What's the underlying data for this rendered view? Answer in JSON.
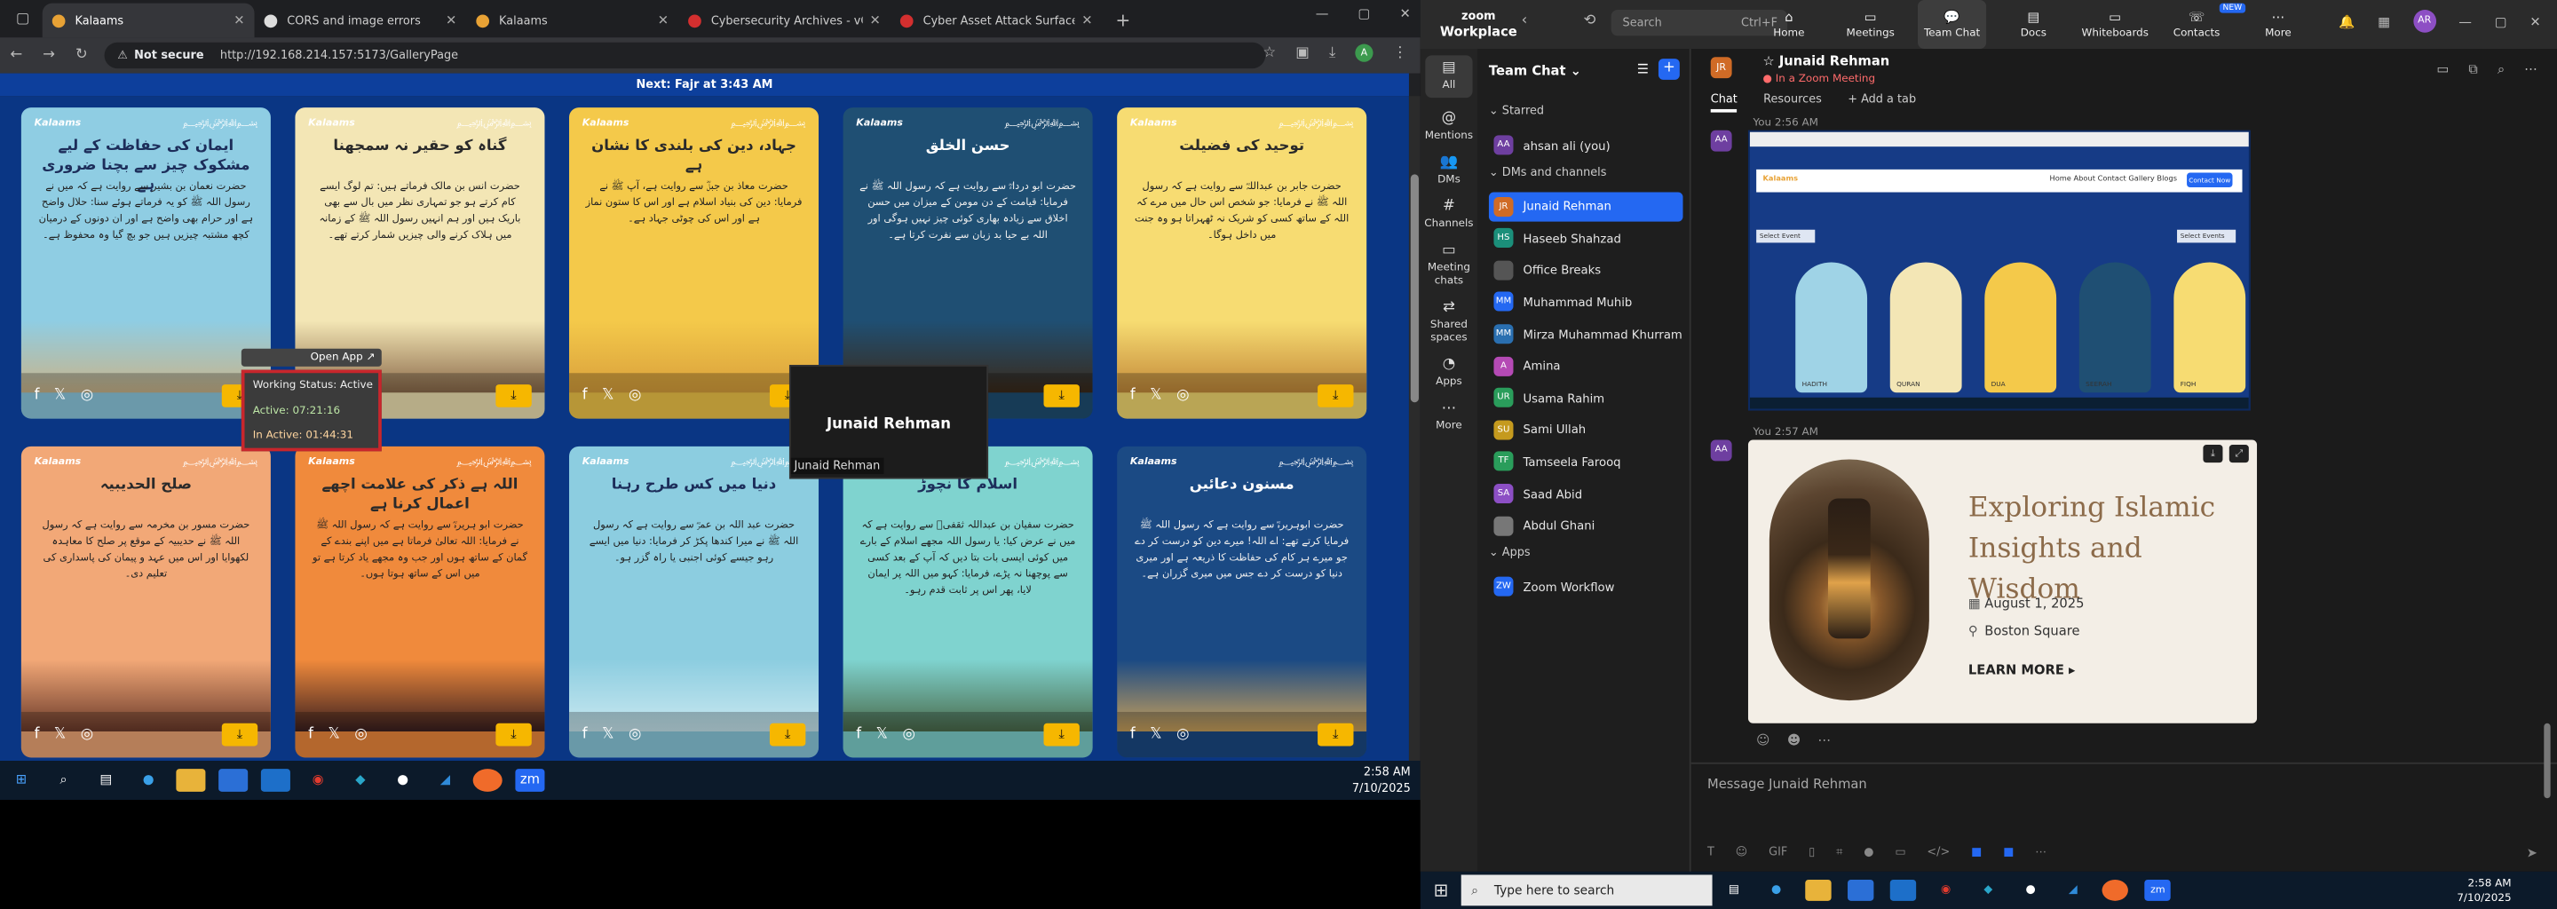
{
  "browser": {
    "tabs": [
      {
        "title": "Kalaams",
        "active": true,
        "color": "#e8a235"
      },
      {
        "title": "CORS and image errors",
        "active": false,
        "color": "#dddddd"
      },
      {
        "title": "Kalaams",
        "active": false,
        "color": "#e8a235"
      },
      {
        "title": "Cybersecurity Archives - vClou",
        "active": false,
        "color": "#d32f2f"
      },
      {
        "title": "Cyber Asset Attack Surface Ma",
        "active": false,
        "color": "#d32f2f"
      }
    ],
    "security_label": "Not secure",
    "url": "http://192.168.214.157:5173/GalleryPage",
    "banner": "Next: Fajr at 3:43 AM"
  },
  "gallery": {
    "logo": "Kalaams",
    "cards": [
      {
        "title": "ایمان کی حفاظت کے لیے مشکوک چیز سے بچنا ضروری ہے",
        "body": "حضرت نعمان بن بشیر سے روایت ہے کہ میں نے رسول اللہ ﷺ کو یہ فرماتے ہوئے سنا: حلال واضح ہے اور حرام بھی واضح ہے اور ان دونوں کے درمیان کچھ مشتبہ چیزیں ہیں جو بچ گیا وہ محفوظ ہے۔",
        "bg": "#8fcde3",
        "title_color": "#1c2d5a"
      },
      {
        "title": "گناہ کو حقیر نہ سمجھنا",
        "body": "حضرت انس بن مالک فرماتے ہیں: تم لوگ ایسے کام کرتے ہو جو تمہاری نظر میں بال سے بھی باریک ہیں اور ہم انہیں رسول اللہ ﷺ کے زمانہ میں ہلاک کرنے والی چیزیں شمار کرتے تھے۔",
        "bg": "#f3e6b5",
        "title_color": "#2a2a2a"
      },
      {
        "title": "جہاد، دین کی بلندی کا نشان ہے",
        "body": "حضرت معاذ بن جبلؓ سے روایت ہے، آپ ﷺ نے فرمایا: دین کی بنیاد اسلام ہے اور اس کا ستون نماز ہے اور اس کی چوٹی جہاد ہے۔",
        "bg": "#f4c94a",
        "title_color": "#2a2a2a"
      },
      {
        "title": "حسن الخلق",
        "body": "حضرت ابو درداءؓ سے روایت ہے کہ رسول اللہ ﷺ نے فرمایا: قیامت کے دن مومن کے میزان میں حسن اخلاق سے زیادہ بھاری کوئی چیز نہیں ہوگی اور اللہ بے حیا بد زبان سے نفرت کرتا ہے۔",
        "bg": "#1f4f73",
        "title_color": "#ffffff"
      },
      {
        "title": "توحید کی فضیلت",
        "body": "حضرت جابر بن عبداللہؓ سے روایت ہے کہ رسول اللہ ﷺ نے فرمایا: جو شخص اس حال میں مرے کہ اللہ کے ساتھ کسی کو شریک نہ ٹھہراتا ہو وہ جنت میں داخل ہوگا۔",
        "bg": "#f7dc72",
        "title_color": "#2a2a2a"
      },
      {
        "title": "صلح الحدیبیہ",
        "body": "حضرت مسور بن مخرمہ سے روایت ہے کہ رسول اللہ ﷺ نے حدیبیہ کے موقع پر صلح کا معاہدہ لکھوایا اور اس میں عہد و پیمان کی پاسداری کی تعلیم دی۔",
        "bg": "#f2a877",
        "title_color": "#2a2a2a"
      },
      {
        "title": "اللہ ہے ذکر کی علامت اچھے اعمال کرنا ہے",
        "body": "حضرت ابو ہریرہؓ سے روایت ہے کہ رسول اللہ ﷺ نے فرمایا: اللہ تعالیٰ فرماتا ہے میں اپنے بندے کے گمان کے ساتھ ہوں اور جب وہ مجھے یاد کرتا ہے تو میں اس کے ساتھ ہوتا ہوں۔",
        "bg": "#f08a3c",
        "title_color": "#2a2a2a"
      },
      {
        "title": "دنیا میں کس طرح رہنا",
        "body": "حضرت عبد اللہ بن عمرؓ سے روایت ہے کہ رسول اللہ ﷺ نے میرا کندھا پکڑ کر فرمایا: دنیا میں ایسے رہو جیسے کوئی اجنبی یا راہ گزر ہو۔",
        "bg": "#8ccde0",
        "title_color": "#1c2d5a"
      },
      {
        "title": "اسلام کا نچوڑ",
        "body": "حضرت سفیان بن عبداللہ ثقفیؓ سے روایت ہے کہ میں نے عرض کیا: یا رسول اللہ مجھے اسلام کے بارے میں کوئی ایسی بات بتا دیں کہ آپ کے بعد کسی سے پوچھنا نہ پڑے، فرمایا: کہو میں اللہ پر ایمان لایا، پھر اس پر ثابت قدم رہو۔",
        "bg": "#7fd3cf",
        "title_color": "#1c2d5a"
      },
      {
        "title": "مسنون دعائیں",
        "body": "حضرت ابوہریرہؓ سے روایت ہے کہ رسول اللہ ﷺ فرمایا کرتے تھے: اے اللہ! میرے دین کو درست کر دے جو میرے ہر کام کی حفاظت کا ذریعہ ہے اور میری دنیا کو درست کر دے جس میں میری گزران ہے۔",
        "bg": "#1b4a84",
        "title_color": "#ffffff"
      }
    ]
  },
  "overlay": {
    "open_app": "Open App ↗",
    "working_status": "Working Status: Active",
    "active": "Active: 07:21:16",
    "inactive": "In Active: 01:44:31",
    "popup_name": "Junaid Rehman",
    "popup_sub": "Junaid Rehman"
  },
  "left_taskbar": {
    "time": "2:58 AM",
    "date": "7/10/2025"
  },
  "zoom": {
    "logo_top": "zoom",
    "logo_bottom": "Workplace",
    "search": "Search",
    "search_shortcut": "Ctrl+F",
    "nav": [
      "Home",
      "Meetings",
      "Team Chat",
      "Docs",
      "Whiteboards",
      "Contacts",
      "More"
    ],
    "new_badge": "NEW",
    "avatar": "AR",
    "rail": [
      "All",
      "Mentions",
      "DMs",
      "Channels",
      "Meeting chats",
      "Shared spaces",
      "Apps",
      "More"
    ],
    "team_chat": "Team Chat",
    "starred": "Starred",
    "starred_items": [
      {
        "name": "ahsan ali (you)",
        "initials": "AA",
        "color": "#6e3fa0"
      }
    ],
    "dms_header": "DMs and channels",
    "dms": [
      {
        "name": "Junaid Rehman",
        "initials": "JR",
        "color": "#d06b26",
        "selected": true
      },
      {
        "name": "Haseeb Shahzad",
        "initials": "HS",
        "color": "#1b8f7a"
      },
      {
        "name": "Office Breaks",
        "initials": "",
        "color": "#555555"
      },
      {
        "name": "Muhammad Muhib",
        "initials": "MM",
        "color": "#2468f2"
      },
      {
        "name": "Mirza Muhammad Khurram",
        "initials": "MM",
        "color": "#2a6fb0"
      },
      {
        "name": "Amina",
        "initials": "A",
        "color": "#b54ab5"
      },
      {
        "name": "Usama Rahim",
        "initials": "UR",
        "color": "#2a9d5b"
      },
      {
        "name": "Sami Ullah",
        "initials": "SU",
        "color": "#c59a1e"
      },
      {
        "name": "Tamseela Farooq",
        "initials": "TF",
        "color": "#2a9d5b"
      },
      {
        "name": "Saad Abid",
        "initials": "SA",
        "color": "#8c4fc4"
      },
      {
        "name": "Abdul Ghani",
        "initials": "",
        "color": "#777777"
      }
    ],
    "apps_header": "Apps",
    "apps": [
      {
        "name": "Zoom Workflow",
        "initials": "ZW",
        "color": "#2468f2"
      }
    ],
    "chat": {
      "name": "Junaid Rehman",
      "status": "In a Zoom Meeting",
      "initials": "JR",
      "tabs": [
        "Chat",
        "Resources",
        "+ Add a tab"
      ],
      "msg1_time": "You 2:56 AM",
      "msg2_time": "You 2:57 AM",
      "msg_avatar": "AA",
      "shot_select1": "Select Event",
      "shot_select2": "Select Events",
      "shot_contact": "Contact Now",
      "shot_links": "Home  About  Contact  Gallery  Blogs",
      "shot_captions": [
        "HADITH",
        "QURAN",
        "DUA",
        "SEERAH",
        "FIQH"
      ],
      "post_heading": "Exploring Islamic Insights and Wisdom",
      "post_date": "August 1, 2025",
      "post_location": "Boston Square",
      "post_cta": "LEARN MORE ▸",
      "placeholder": "Message Junaid Rehman"
    }
  },
  "right_taskbar": {
    "search": "Type here to search",
    "time": "2:58 AM",
    "date": "7/10/2025"
  }
}
